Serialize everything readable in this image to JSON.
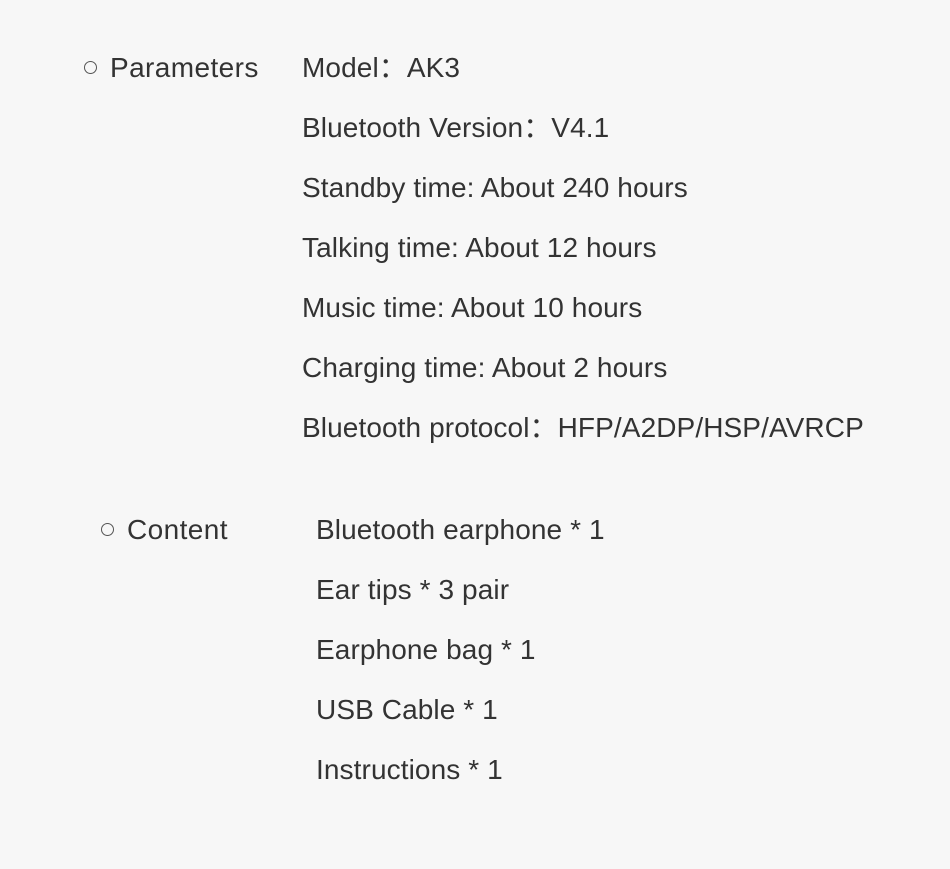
{
  "background_color": "#f7f7f7",
  "text_color": "#333333",
  "sections": [
    {
      "bullet": "hollow-circle",
      "label": "Parameters",
      "lines": [
        "Model：AK3",
        "Bluetooth Version：V4.1",
        "Standby time: About 240 hours",
        "Talking time: About 12 hours",
        "Music time: About 10 hours",
        "Charging time: About 2 hours",
        "Bluetooth protocol：HFP/A2DP/HSP/AVRCP"
      ]
    },
    {
      "bullet": "hollow-circle",
      "label": "Content",
      "lines": [
        "Bluetooth earphone * 1",
        "Ear tips * 3 pair",
        "Earphone bag * 1",
        "USB Cable * 1",
        "Instructions * 1"
      ]
    }
  ]
}
